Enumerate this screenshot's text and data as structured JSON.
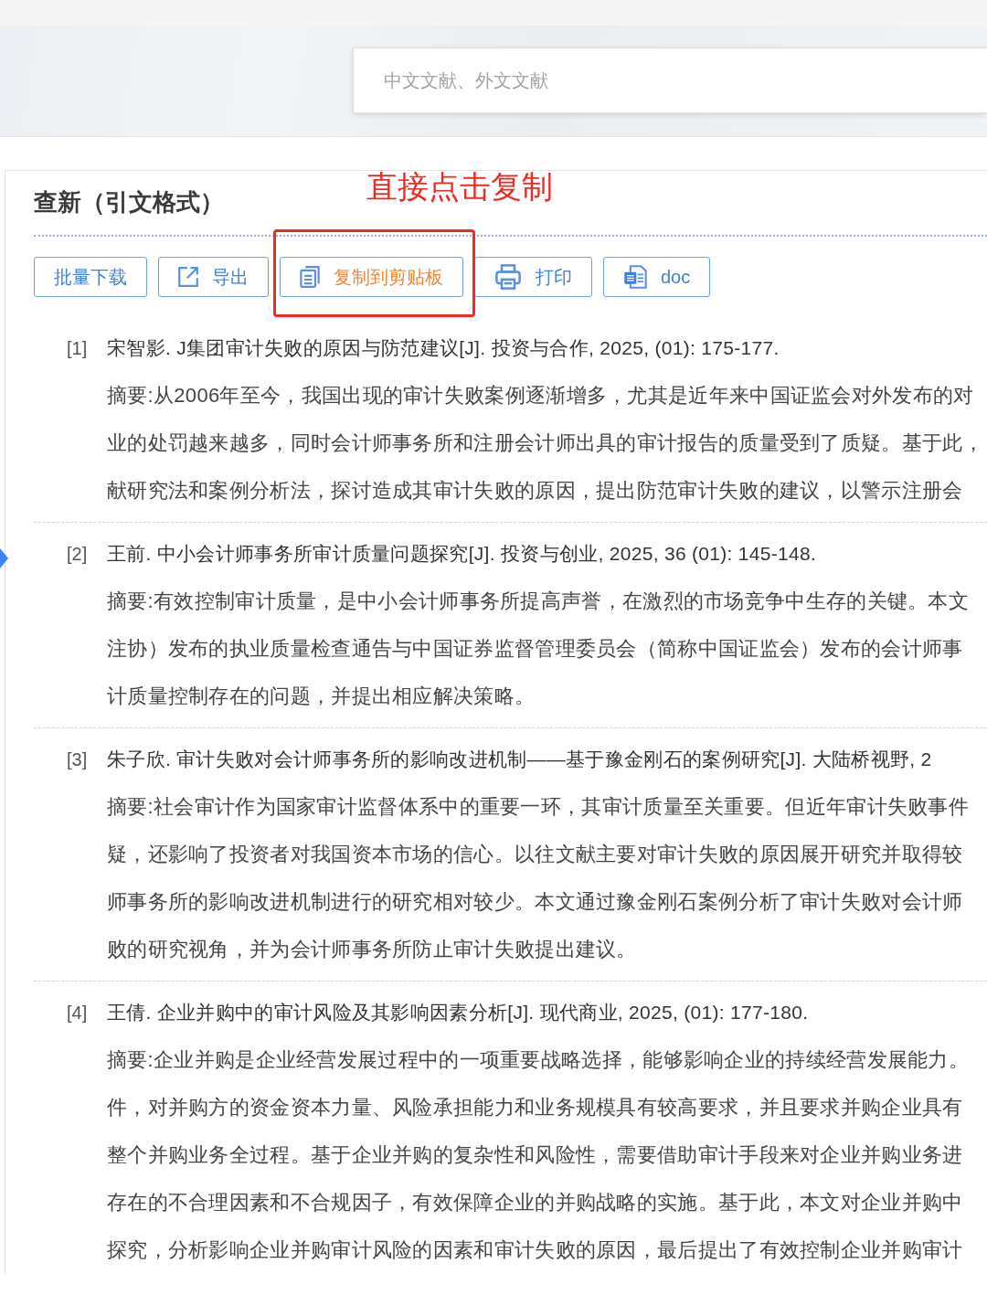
{
  "search": {
    "placeholder": "中文文献、外文文献"
  },
  "panel": {
    "title": "查新（引文格式）"
  },
  "annotation": {
    "text": "直接点击复制"
  },
  "toolbar": {
    "buttons": [
      {
        "kind": "text",
        "label": "批量下载",
        "highlighted": false,
        "annotated": false
      },
      {
        "kind": "export",
        "label": "导出",
        "highlighted": false,
        "annotated": false
      },
      {
        "kind": "copy",
        "label": "复制到剪贴板",
        "highlighted": true,
        "annotated": true
      },
      {
        "kind": "print",
        "label": "打印",
        "highlighted": false,
        "annotated": false
      },
      {
        "kind": "doc",
        "label": "doc",
        "highlighted": false,
        "annotated": false
      }
    ]
  },
  "references": [
    {
      "number": "[1]",
      "citation": "宋智影. J集团审计失败的原因与防范建议[J]. 投资与合作, 2025, (01): 175-177.",
      "abstract_lines": [
        "摘要:从2006年至今，我国出现的审计失败案例逐渐增多，尤其是近年来中国证监会对外发布的对",
        "业的处罚越来越多，同时会计师事务所和注册会计师出具的审计报告的质量受到了质疑。基于此，",
        "献研究法和案例分析法，探讨造成其审计失败的原因，提出防范审计失败的建议，以警示注册会"
      ]
    },
    {
      "number": "[2]",
      "citation": "王前. 中小会计师事务所审计质量问题探究[J]. 投资与创业, 2025, 36 (01): 145-148.",
      "abstract_lines": [
        "摘要:有效控制审计质量，是中小会计师事务所提高声誉，在激烈的市场竞争中生存的关键。本文",
        "注协）发布的执业质量检查通告与中国证券监督管理委员会（简称中国证监会）发布的会计师事",
        "计质量控制存在的问题，并提出相应解决策略。"
      ]
    },
    {
      "number": "[3]",
      "citation": "朱子欣. 审计失败对会计师事务所的影响改进机制——基于豫金刚石的案例研究[J]. 大陆桥视野, 2",
      "abstract_lines": [
        "摘要:社会审计作为国家审计监督体系中的重要一环，其审计质量至关重要。但近年审计失败事件",
        "疑，还影响了投资者对我国资本市场的信心。以往文献主要对审计失败的原因展开研究并取得较",
        "师事务所的影响改进机制进行的研究相对较少。本文通过豫金刚石案例分析了审计失败对会计师",
        "败的研究视角，并为会计师事务所防止审计失败提出建议。"
      ]
    },
    {
      "number": "[4]",
      "citation": "王倩. 企业并购中的审计风险及其影响因素分析[J]. 现代商业, 2025, (01): 177-180.",
      "abstract_lines": [
        "摘要:企业并购是企业经营发展过程中的一项重要战略选择，能够影响企业的持续经营发展能力。",
        "件，对并购方的资金资本力量、风险承担能力和业务规模具有较高要求，并且要求并购企业具有",
        "整个并购业务全过程。基于企业并购的复杂性和风险性，需要借助审计手段来对企业并购业务进",
        "存在的不合理因素和不合规因子，有效保障企业的并购战略的实施。基于此，本文对企业并购中",
        "探究，分析影响企业并购审计风险的因素和审计失败的原因，最后提出了有效控制企业并购审计"
      ]
    }
  ]
}
